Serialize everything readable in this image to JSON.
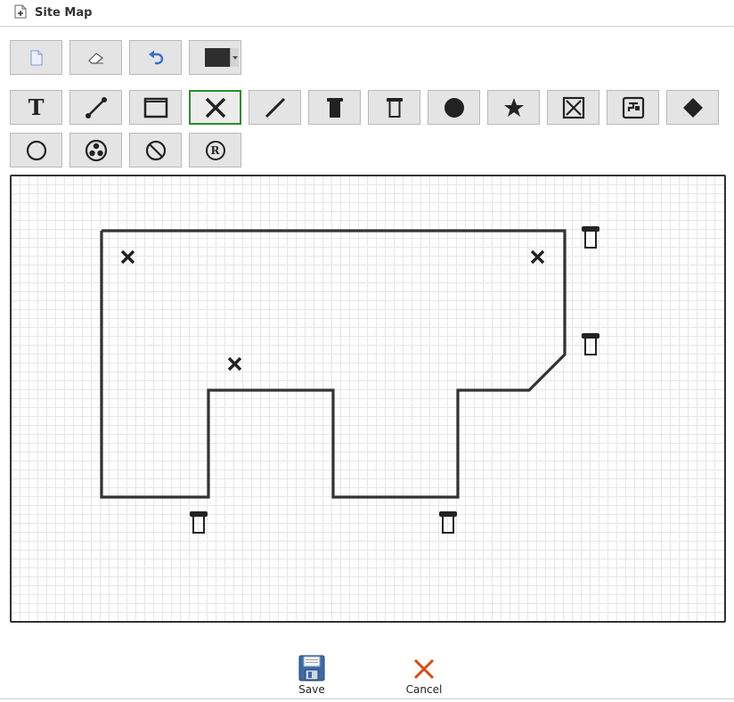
{
  "window": {
    "title": "Site Map"
  },
  "toolbar": {
    "row1": [
      {
        "name": "new-page-button",
        "icon": "new-page-icon"
      },
      {
        "name": "eraser-button",
        "icon": "eraser-icon"
      },
      {
        "name": "undo-button",
        "icon": "undo-icon"
      },
      {
        "name": "color-picker",
        "icon": "color-swatch",
        "color": "#2e2e2e"
      }
    ],
    "row2": [
      {
        "name": "text-tool",
        "icon": "text-icon",
        "glyph": "T"
      },
      {
        "name": "line-tool",
        "icon": "line-segment-icon"
      },
      {
        "name": "rectangle-tool",
        "icon": "rectangle-icon"
      },
      {
        "name": "x-marker-tool",
        "icon": "x-marker-icon",
        "selected": true
      },
      {
        "name": "diagonal-line-tool",
        "icon": "diagonal-line-icon"
      },
      {
        "name": "post-filled-tool",
        "icon": "post-filled-icon"
      },
      {
        "name": "post-outline-tool",
        "icon": "post-outline-icon"
      },
      {
        "name": "circle-filled-tool",
        "icon": "filled-circle-icon"
      },
      {
        "name": "star-tool",
        "icon": "star-icon"
      },
      {
        "name": "box-x-tool",
        "icon": "box-x-icon"
      },
      {
        "name": "faucet-tool",
        "icon": "faucet-icon"
      },
      {
        "name": "diamond-tool",
        "icon": "diamond-icon"
      }
    ],
    "row3": [
      {
        "name": "circle-outline-tool",
        "icon": "circle-outline-icon"
      },
      {
        "name": "triple-circle-tool",
        "icon": "triple-circle-icon"
      },
      {
        "name": "prohibited-tool",
        "icon": "prohibited-icon"
      },
      {
        "name": "registered-tool",
        "icon": "registered-icon",
        "glyph": "R"
      }
    ]
  },
  "actions": {
    "save_label": "Save",
    "cancel_label": "Cancel"
  },
  "colors": {
    "accent_selected": "#2e8b2e",
    "cancel_icon": "#d94a14",
    "save_icon": "#3a6aa8",
    "stroke": "#333333"
  }
}
